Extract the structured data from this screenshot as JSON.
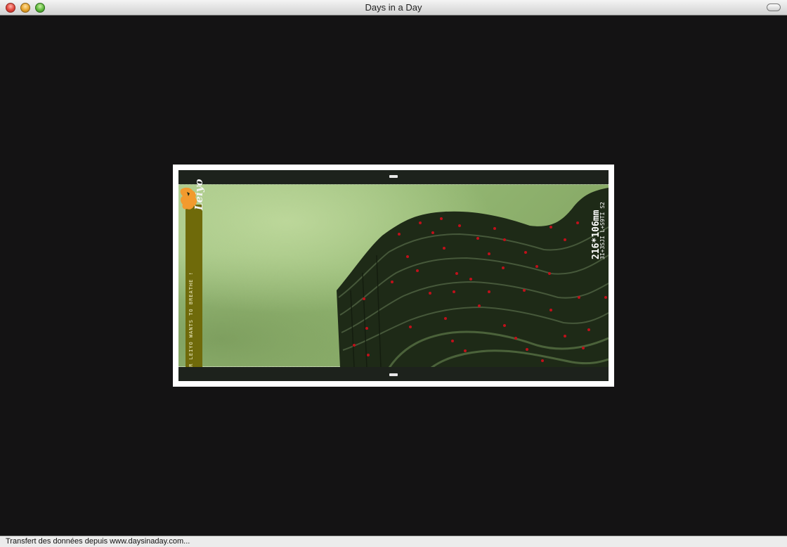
{
  "window": {
    "title": "Days in a Day"
  },
  "artwork": {
    "caption": "MR LEIYO WANTS TO BREATHE !",
    "logo_text": "Leiyo",
    "dimensions": "216*106mm",
    "subtitle": "3I+3SJI L+S9TI S2",
    "marker_color": "#c0101a",
    "sidebar_color": "#6f6a0a",
    "map_color": "#f29a2e"
  },
  "status": {
    "text": "Transfert des données depuis www.daysinaday.com..."
  }
}
